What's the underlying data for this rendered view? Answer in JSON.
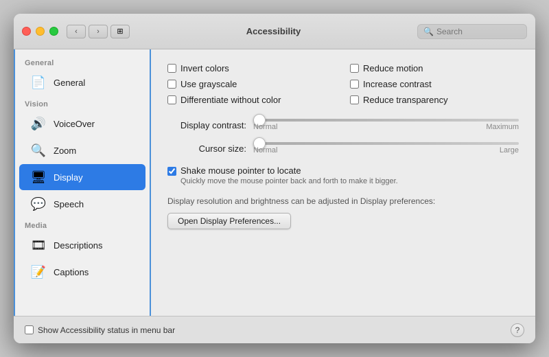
{
  "window": {
    "title": "Accessibility"
  },
  "titlebar": {
    "back_label": "‹",
    "forward_label": "›",
    "grid_label": "⊞",
    "search_placeholder": "Search"
  },
  "sidebar": {
    "sections": [
      {
        "label": "General",
        "items": [
          {
            "id": "general",
            "label": "General",
            "icon": "📄",
            "active": false
          }
        ]
      },
      {
        "label": "Vision",
        "items": [
          {
            "id": "voiceover",
            "label": "VoiceOver",
            "icon": "🔊",
            "active": false
          },
          {
            "id": "zoom",
            "label": "Zoom",
            "icon": "🔍",
            "active": false
          },
          {
            "id": "display",
            "label": "Display",
            "icon": "🖥",
            "active": true
          },
          {
            "id": "speech",
            "label": "Speech",
            "icon": "💬",
            "active": false
          }
        ]
      },
      {
        "label": "Media",
        "items": [
          {
            "id": "descriptions",
            "label": "Descriptions",
            "icon": "🎞",
            "active": false
          },
          {
            "id": "captions",
            "label": "Captions",
            "icon": "📝",
            "active": false
          }
        ]
      }
    ]
  },
  "content": {
    "checkboxes": [
      {
        "id": "invert-colors",
        "label": "Invert colors",
        "checked": false
      },
      {
        "id": "reduce-motion",
        "label": "Reduce motion",
        "checked": false
      },
      {
        "id": "use-grayscale",
        "label": "Use grayscale",
        "checked": false
      },
      {
        "id": "increase-contrast",
        "label": "Increase contrast",
        "checked": false
      },
      {
        "id": "differentiate-without-color",
        "label": "Differentiate without color",
        "checked": false
      },
      {
        "id": "reduce-transparency",
        "label": "Reduce transparency",
        "checked": false
      }
    ],
    "display_contrast": {
      "label": "Display contrast:",
      "min_label": "Normal",
      "max_label": "Maximum",
      "value": 0
    },
    "cursor_size": {
      "label": "Cursor size:",
      "min_label": "Normal",
      "max_label": "Large",
      "value": 0
    },
    "shake": {
      "label": "Shake mouse pointer to locate",
      "sublabel": "Quickly move the mouse pointer back and forth to make it bigger.",
      "checked": true
    },
    "display_note": "Display resolution and brightness can be adjusted in Display preferences:",
    "open_prefs_btn": "Open Display Preferences..."
  },
  "bottombar": {
    "show_accessibility_label": "Show Accessibility status in menu bar",
    "help_label": "?"
  }
}
